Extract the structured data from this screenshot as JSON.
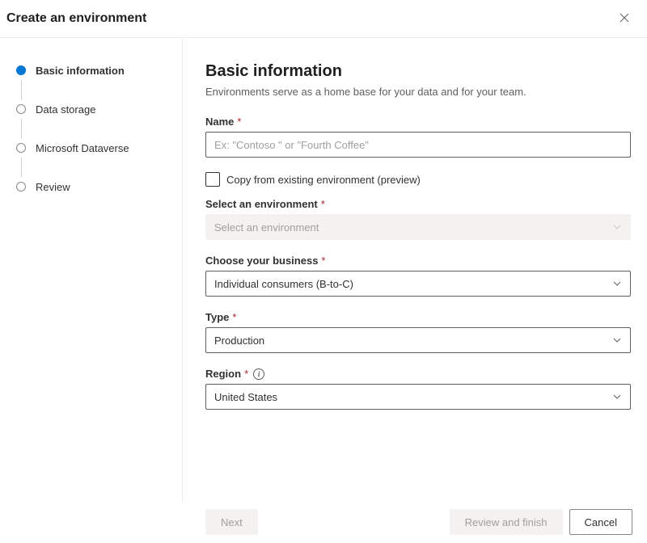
{
  "header": {
    "title": "Create an environment"
  },
  "steps": [
    {
      "label": "Basic information",
      "active": true
    },
    {
      "label": "Data storage",
      "active": false
    },
    {
      "label": "Microsoft Dataverse",
      "active": false
    },
    {
      "label": "Review",
      "active": false
    }
  ],
  "page": {
    "title": "Basic information",
    "description": "Environments serve as a home base for your data and for your team."
  },
  "fields": {
    "name": {
      "label": "Name",
      "placeholder": "Ex: \"Contoso \" or \"Fourth Coffee\"",
      "value": ""
    },
    "copy_checkbox": {
      "label": "Copy from existing environment (preview)",
      "checked": false
    },
    "select_env": {
      "label": "Select an environment",
      "placeholder": "Select an environment"
    },
    "business": {
      "label": "Choose your business",
      "value": "Individual consumers (B-to-C)"
    },
    "type": {
      "label": "Type",
      "value": "Production"
    },
    "region": {
      "label": "Region",
      "value": "United States"
    }
  },
  "footer": {
    "next": "Next",
    "review": "Review and finish",
    "cancel": "Cancel"
  }
}
